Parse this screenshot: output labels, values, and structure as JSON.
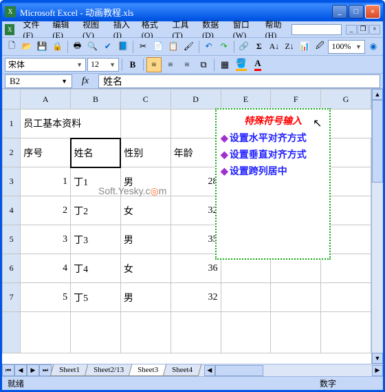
{
  "title": "Microsoft Excel - 动画教程.xls",
  "menu": {
    "file": "文件(F)",
    "edit": "编辑(E)",
    "view": "视图(V)",
    "insert": "插入(I)",
    "format": "格式(O)",
    "tools": "工具(T)",
    "data": "数据(D)",
    "window": "窗口(W)",
    "help": "帮助(H)"
  },
  "zoom": "100%",
  "font": {
    "name": "宋体",
    "size": "12"
  },
  "namebox": "B2",
  "formulabar": "姓名",
  "columns": [
    "A",
    "B",
    "C",
    "D",
    "E",
    "F",
    "G"
  ],
  "rows": [
    "1",
    "2",
    "3",
    "4",
    "5",
    "6",
    "7"
  ],
  "cells": {
    "A1": "员工基本资料",
    "A2": "序号",
    "B2": "姓名",
    "C2": "性别",
    "D2": "年龄",
    "A3": "1",
    "B3": "丁1",
    "C3": "男",
    "D3": "28",
    "A4": "2",
    "B4": "丁2",
    "C4": "女",
    "D4": "32",
    "A5": "3",
    "B5": "丁3",
    "C5": "男",
    "D5": "35",
    "A6": "4",
    "B6": "丁4",
    "C6": "女",
    "D6": "36",
    "A7": "5",
    "B7": "丁5",
    "C7": "男",
    "D7": "32"
  },
  "overlay": {
    "title": "特殊符号输入",
    "items": [
      "设置水平对齐方式",
      "设置垂直对齐方式",
      "设置跨列居中"
    ]
  },
  "tabs": [
    "Sheet1",
    "Sheet2/13",
    "Sheet3",
    "Sheet4"
  ],
  "status": {
    "ready": "就绪",
    "mode": "数字"
  },
  "watermark": "Soft.Yesky.c  m"
}
